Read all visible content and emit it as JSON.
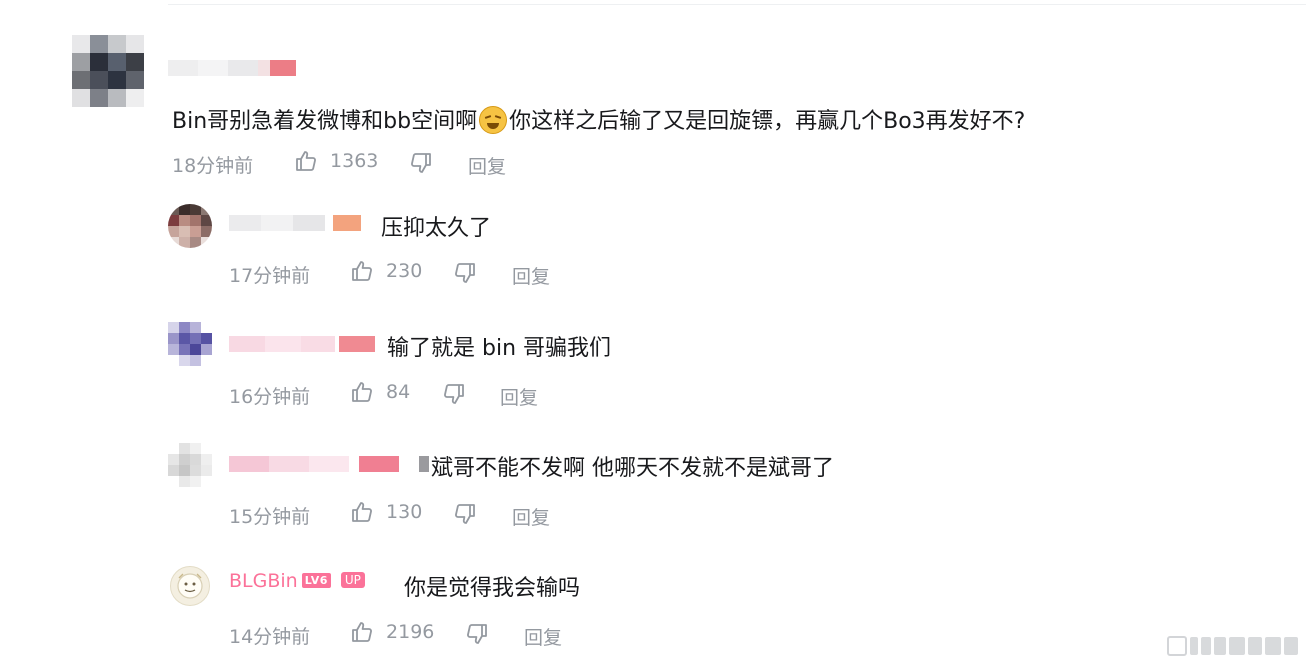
{
  "comments": [
    {
      "text": "Bin哥别急着发微博和bb空间啊",
      "text_after_emoji": "你这样之后输了又是回旋镖，再赢几个Bo3再发好不?",
      "time": "18分钟前",
      "likes": "1363",
      "reply_label": "回复"
    }
  ],
  "replies": [
    {
      "text": "压抑太久了",
      "time": "17分钟前",
      "likes": "230",
      "reply_label": "回复"
    },
    {
      "text": "输了就是 bin 哥骗我们",
      "time": "16分钟前",
      "likes": "84",
      "reply_label": "回复"
    },
    {
      "text": "斌哥不能不发啊 他哪天不发就不是斌哥了",
      "time": "15分钟前",
      "likes": "130",
      "reply_label": "回复"
    },
    {
      "username": "BLGBin",
      "level_badge": "LV6",
      "up_badge": "UP",
      "text": "你是觉得我会输吗",
      "time": "14分钟前",
      "likes": "2196",
      "reply_label": "回复"
    }
  ],
  "icons": {
    "like": "thumbs-up-icon",
    "dislike": "thumbs-down-icon",
    "emoji": "sweat-smile-emoji"
  },
  "colors": {
    "text": "#18191c",
    "meta": "#9499a0",
    "pink": "#fb7299"
  }
}
